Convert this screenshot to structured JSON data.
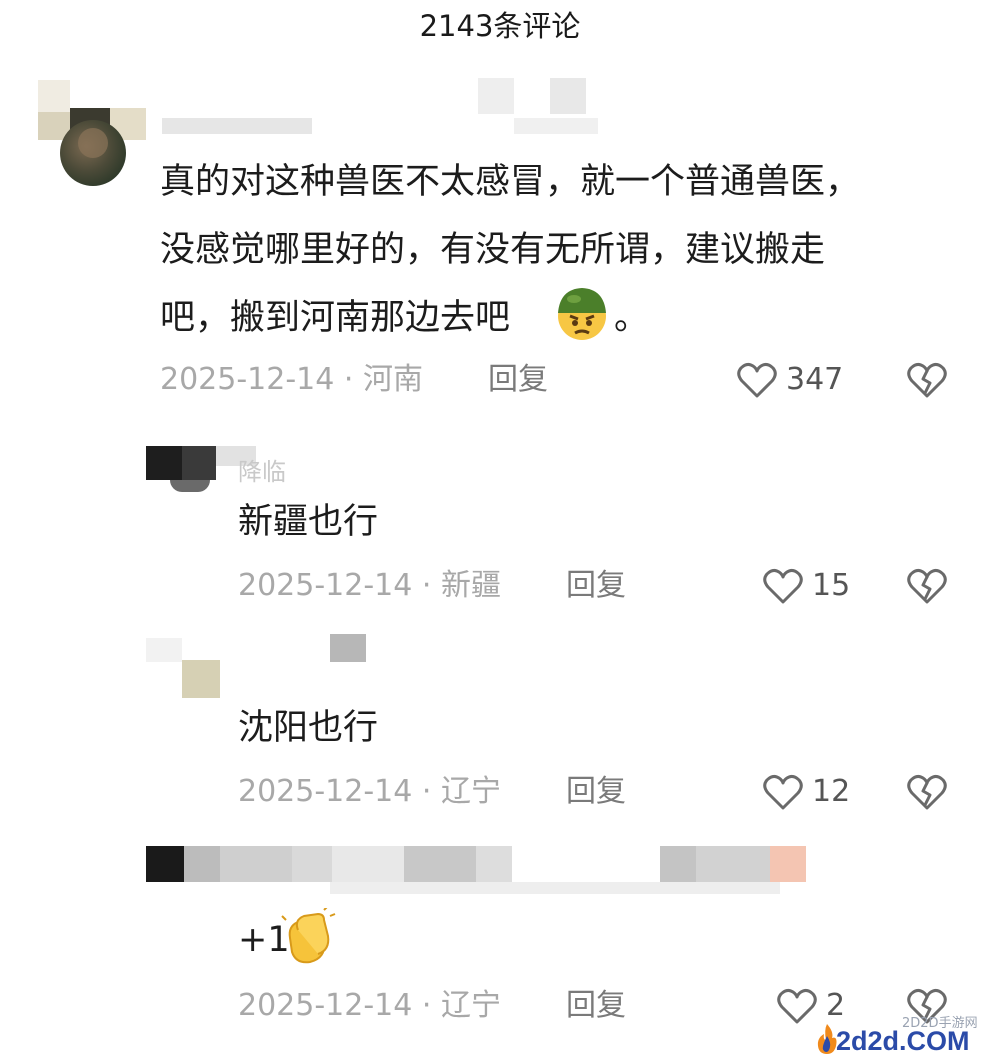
{
  "header": {
    "title": "2143条评论"
  },
  "comments": [
    {
      "text_lines": [
        "真的对这种兽医不太感冒，就一个普通兽医，",
        "没感觉哪里好的，有没有无所谓，建议搬走",
        "吧，搬到河南那边去吧",
        "。"
      ],
      "emoji": "angry-soldier-emoji",
      "date": "2025-12-14 · 河南",
      "reply_label": "回复",
      "like_count": "347"
    },
    {
      "user_partial": "降临",
      "text_lines": [
        "新疆也行"
      ],
      "date": "2025-12-14 · 新疆",
      "reply_label": "回复",
      "like_count": "15"
    },
    {
      "text_lines": [
        "沈阳也行"
      ],
      "date": "2025-12-14 · 辽宁",
      "reply_label": "回复",
      "like_count": "12"
    },
    {
      "text_lines": [
        "+1"
      ],
      "emoji": "clapping-hands-emoji",
      "date": "2025-12-14 · 辽宁",
      "reply_label": "回复",
      "like_count": "2"
    }
  ],
  "icons": {
    "like": "heart-outline-icon",
    "dislike": "broken-heart-icon"
  },
  "watermark": {
    "small": "2D2D手游网",
    "big": "2d2d.COM"
  },
  "colors": {
    "meta": "#a8a8a8",
    "text": "#1c1c1c",
    "watermark": "#2b4ba8"
  }
}
